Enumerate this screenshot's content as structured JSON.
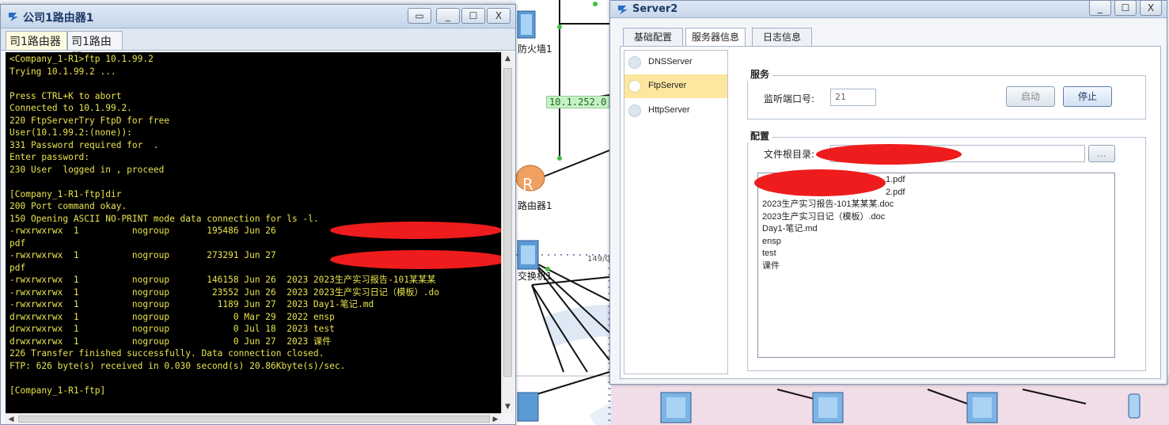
{
  "canvas": {
    "labels": {
      "firewall": "防火墙1",
      "router": "路由器1",
      "switch": "交换机1",
      "partial_tag": "149/0"
    },
    "ip_tag": "10.1.252.0"
  },
  "terminal": {
    "title": "公司1路由器1",
    "tabs": [
      "司1路由器",
      "司1路由器"
    ],
    "buttons": {
      "restore": "▭",
      "minimize": "_",
      "maximize": "☐",
      "close": "X"
    },
    "lines": [
      "<Company_1-R1>ftp 10.1.99.2",
      "Trying 10.1.99.2 ...",
      "",
      "Press CTRL+K to abort",
      "Connected to 10.1.99.2.",
      "220 FtpServerTry FtpD for free",
      "User(10.1.99.2:(none)):",
      "331 Password required for  .",
      "Enter password:",
      "230 User  logged in , proceed",
      "",
      "[Company_1-R1-ftp]dir",
      "200 Port command okay.",
      "150 Opening ASCII NO-PRINT mode data connection for ls -l.",
      "-rwxrwxrwx  1          nogroup       195486 Jun 26",
      "pdf",
      "-rwxrwxrwx  1          nogroup       273291 Jun 27",
      "pdf",
      "-rwxrwxrwx  1          nogroup       146158 Jun 26  2023 2023生产实习报告-101某某某",
      "-rwxrwxrwx  1          nogroup        23552 Jun 26  2023 2023生产实习日记（模板）.do",
      "-rwxrwxrwx  1          nogroup         1189 Jun 27  2023 Day1-笔记.md",
      "drwxrwxrwx  1          nogroup            0 Mar 29  2022 ensp",
      "drwxrwxrwx  1          nogroup            0 Jul 18  2023 test",
      "drwxrwxrwx  1          nogroup            0 Jun 27  2023 课件",
      "226 Transfer finished successfully. Data connection closed.",
      "FTP: 626 byte(s) received in 0.030 second(s) 20.86Kbyte(s)/sec.",
      "",
      "[Company_1-R1-ftp]"
    ]
  },
  "server": {
    "title": "Server2",
    "buttons": {
      "minimize": "_",
      "maximize": "☐",
      "close": "X"
    },
    "tabs": [
      "基础配置",
      "服务器信息",
      "日志信息"
    ],
    "services": [
      "DNSServer",
      "FtpServer",
      "HttpServer"
    ],
    "service_group_title": "服务",
    "port_label": "监听端口号:",
    "port_value": "21",
    "start_button": "启动",
    "stop_button": "停止",
    "config_group_title": "配置",
    "root_dir_label": "文件根目录:",
    "browse_button": "...",
    "files": [
      "1.pdf",
      "2.pdf",
      "2023生产实习报告-101某某某.doc",
      "2023生产实习日记（模板）.doc",
      "Day1-笔记.md",
      "ensp",
      "test",
      "课件"
    ]
  },
  "colors": {
    "terminal_bg": "#000000",
    "terminal_fg": "#e8e34e",
    "selected_service": "#fde69e",
    "redaction": "#ee1c1c"
  }
}
